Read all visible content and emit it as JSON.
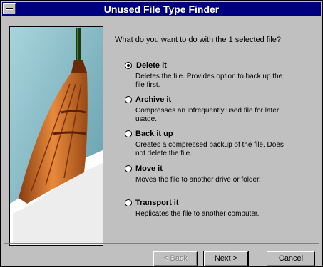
{
  "window": {
    "title": "Unused File Type Finder"
  },
  "prompt": "What do you want to do with the 1 selected file?",
  "options": [
    {
      "label": "Delete it",
      "description": "Deletes the file.  Provides option to back up the file first.",
      "selected": true
    },
    {
      "label": "Archive it",
      "description": "Compresses an infrequently used file for later usage.",
      "selected": false
    },
    {
      "label": "Back it up",
      "description": "Creates a compressed backup of the file.  Does not delete the file.",
      "selected": false
    },
    {
      "label": "Move it",
      "description": "Moves the file to another drive or folder.",
      "selected": false
    },
    {
      "label": "Transport it",
      "description": "Replicates the file to another computer.",
      "selected": false
    }
  ],
  "buttons": {
    "back": "< Back",
    "next": "Next >",
    "cancel": "Cancel"
  },
  "colors": {
    "titlebar": "#00007F",
    "face": "#C0C0C0",
    "sky": "#7FB8C4",
    "broom": "#D9782F"
  }
}
